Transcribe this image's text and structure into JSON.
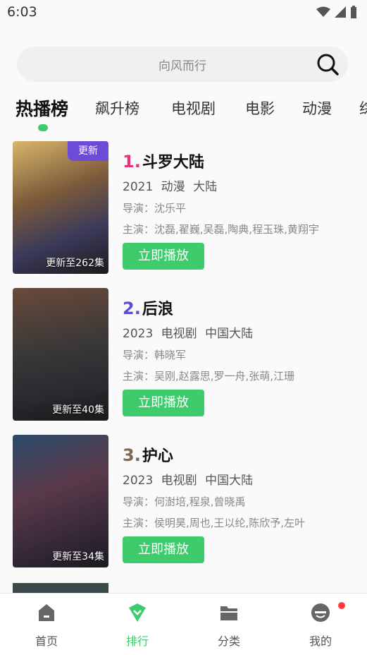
{
  "status_bar": {
    "time": "6:03"
  },
  "search": {
    "placeholder": "向风而行"
  },
  "tabs": [
    {
      "label": "热播榜",
      "active": true
    },
    {
      "label": "飙升榜"
    },
    {
      "label": "电视剧"
    },
    {
      "label": "电影"
    },
    {
      "label": "动漫"
    },
    {
      "label": "综"
    }
  ],
  "items": [
    {
      "rank": "1.",
      "rank_color": "#e0357a",
      "title": "斗罗大陆",
      "year": "2021",
      "genre": "动漫",
      "region": "大陆",
      "director": "导演：沈乐平",
      "actors": "主演：沈磊,翟巍,吴磊,陶典,程玉珠,黄翔宇",
      "badge": "更新",
      "update": "更新至262集",
      "play": "立即播放"
    },
    {
      "rank": "2.",
      "rank_color": "#5a50d8",
      "title": "后浪",
      "year": "2023",
      "genre": "电视剧",
      "region": "中国大陆",
      "director": "导演：韩晓军",
      "actors": "主演：吴刚,赵露思,罗一舟,张萌,江珊",
      "badge": "",
      "update": "更新至40集",
      "play": "立即播放"
    },
    {
      "rank": "3.",
      "rank_color": "#7a6a55",
      "title": "护心",
      "year": "2023",
      "genre": "电视剧",
      "region": "中国大陆",
      "director": "导演：何澍培,程泉,曾晓禹",
      "actors": "主演：侯明昊,周也,王以纶,陈欣予,左叶",
      "badge": "",
      "update": "更新至34集",
      "play": "立即播放"
    }
  ],
  "bottom_nav": [
    {
      "label": "首页",
      "icon": "home-icon"
    },
    {
      "label": "排行",
      "icon": "ranking-icon",
      "active": true
    },
    {
      "label": "分类",
      "icon": "folder-icon"
    },
    {
      "label": "我的",
      "icon": "profile-icon"
    }
  ],
  "colors": {
    "accent": "#3ecb6b",
    "badge": "#6b4bd8",
    "notification": "#ff3b3b"
  }
}
